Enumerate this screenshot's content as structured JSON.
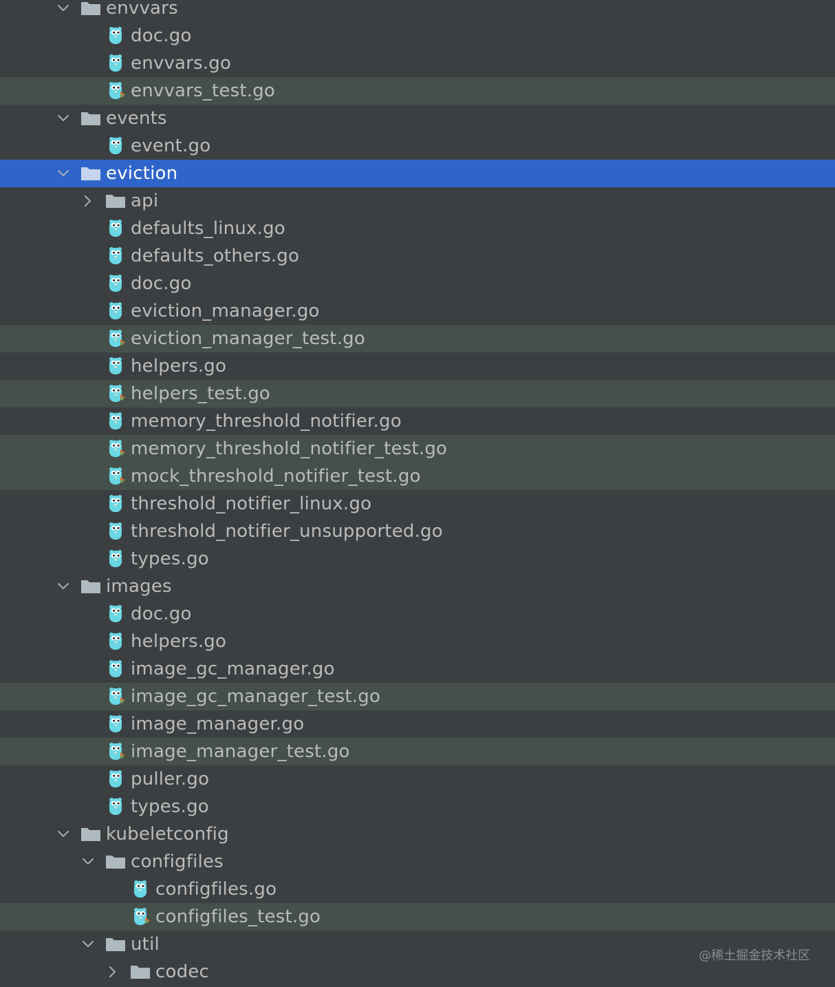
{
  "tree": {
    "rows": [
      {
        "kind": "folder",
        "label": "envvars",
        "depth": 0,
        "expanded": true
      },
      {
        "kind": "file",
        "label": "doc.go",
        "depth": 1
      },
      {
        "kind": "file",
        "label": "envvars.go",
        "depth": 1
      },
      {
        "kind": "test",
        "label": "envvars_test.go",
        "depth": 1
      },
      {
        "kind": "folder",
        "label": "events",
        "depth": 0,
        "expanded": true
      },
      {
        "kind": "file",
        "label": "event.go",
        "depth": 1
      },
      {
        "kind": "folder",
        "label": "eviction",
        "depth": 0,
        "expanded": true,
        "selected": true
      },
      {
        "kind": "folder",
        "label": "api",
        "depth": 1,
        "expanded": false
      },
      {
        "kind": "file",
        "label": "defaults_linux.go",
        "depth": 1
      },
      {
        "kind": "file",
        "label": "defaults_others.go",
        "depth": 1
      },
      {
        "kind": "file",
        "label": "doc.go",
        "depth": 1
      },
      {
        "kind": "file",
        "label": "eviction_manager.go",
        "depth": 1
      },
      {
        "kind": "test",
        "label": "eviction_manager_test.go",
        "depth": 1
      },
      {
        "kind": "file",
        "label": "helpers.go",
        "depth": 1
      },
      {
        "kind": "test",
        "label": "helpers_test.go",
        "depth": 1
      },
      {
        "kind": "file",
        "label": "memory_threshold_notifier.go",
        "depth": 1
      },
      {
        "kind": "test",
        "label": "memory_threshold_notifier_test.go",
        "depth": 1
      },
      {
        "kind": "test",
        "label": "mock_threshold_notifier_test.go",
        "depth": 1
      },
      {
        "kind": "file",
        "label": "threshold_notifier_linux.go",
        "depth": 1
      },
      {
        "kind": "file",
        "label": "threshold_notifier_unsupported.go",
        "depth": 1
      },
      {
        "kind": "file",
        "label": "types.go",
        "depth": 1
      },
      {
        "kind": "folder",
        "label": "images",
        "depth": 0,
        "expanded": true
      },
      {
        "kind": "file",
        "label": "doc.go",
        "depth": 1
      },
      {
        "kind": "file",
        "label": "helpers.go",
        "depth": 1
      },
      {
        "kind": "file",
        "label": "image_gc_manager.go",
        "depth": 1
      },
      {
        "kind": "test",
        "label": "image_gc_manager_test.go",
        "depth": 1
      },
      {
        "kind": "file",
        "label": "image_manager.go",
        "depth": 1
      },
      {
        "kind": "test",
        "label": "image_manager_test.go",
        "depth": 1
      },
      {
        "kind": "file",
        "label": "puller.go",
        "depth": 1
      },
      {
        "kind": "file",
        "label": "types.go",
        "depth": 1
      },
      {
        "kind": "folder",
        "label": "kubeletconfig",
        "depth": 0,
        "expanded": true
      },
      {
        "kind": "folder",
        "label": "configfiles",
        "depth": 1,
        "expanded": true
      },
      {
        "kind": "file",
        "label": "configfiles.go",
        "depth": 2
      },
      {
        "kind": "test",
        "label": "configfiles_test.go",
        "depth": 2
      },
      {
        "kind": "folder",
        "label": "util",
        "depth": 1,
        "expanded": true
      },
      {
        "kind": "folder",
        "label": "codec",
        "depth": 2,
        "expanded": false
      }
    ]
  },
  "watermark": {
    "text": "@稀土掘金技术社区"
  },
  "colors": {
    "background": "#3c3f41",
    "selected_row": "#2f65ca",
    "test_row": "#45504a",
    "text": "#bbbbbb",
    "folder_icon": "#aeb9c0",
    "gopher": "#6ad7e5"
  }
}
